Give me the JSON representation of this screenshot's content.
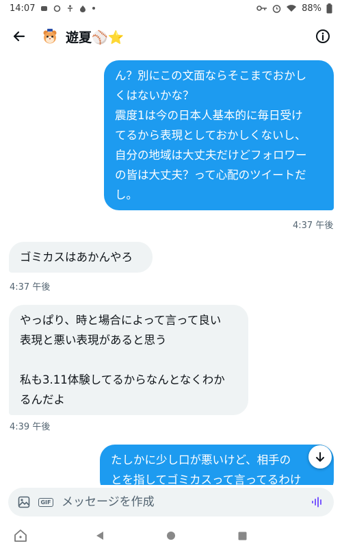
{
  "status_bar": {
    "time": "14:07",
    "battery": "88%"
  },
  "header": {
    "title": "遊夏⚾⭐",
    "avatar_icon": "hamster-avatar"
  },
  "messages": [
    {
      "side": "sent",
      "text": "ん？別にこの文面ならそこまでおかし\nくはないかな？\n震度1は今の日本人基本的に毎日受け\nてるから表現としておかしくないし、\n自分の地域は大丈夫だけどフォロワー\nの皆は大丈夫？って心配のツイートだ\nし。",
      "time": "4:37 午後"
    },
    {
      "side": "recv",
      "text": "ゴミカスはあかんやろ",
      "time": "4:37 午後"
    },
    {
      "side": "recv",
      "text": "やっぱり、時と場合によって言って良い\n表現と悪い表現があると思う\n\n私も3.11体験してるからなんとなくわか\nるんだよ",
      "time": "4:39 午後"
    },
    {
      "side": "sent",
      "text": "たしかに少し口が悪いけど、相手の\nとを指してゴミカスって言ってるわけ",
      "time": ""
    }
  ],
  "composer": {
    "placeholder": "メッセージを作成"
  },
  "colors": {
    "accent": "#1d9bf0",
    "received_bubble": "#eff3f4",
    "voice_icon": "#7856ff"
  }
}
